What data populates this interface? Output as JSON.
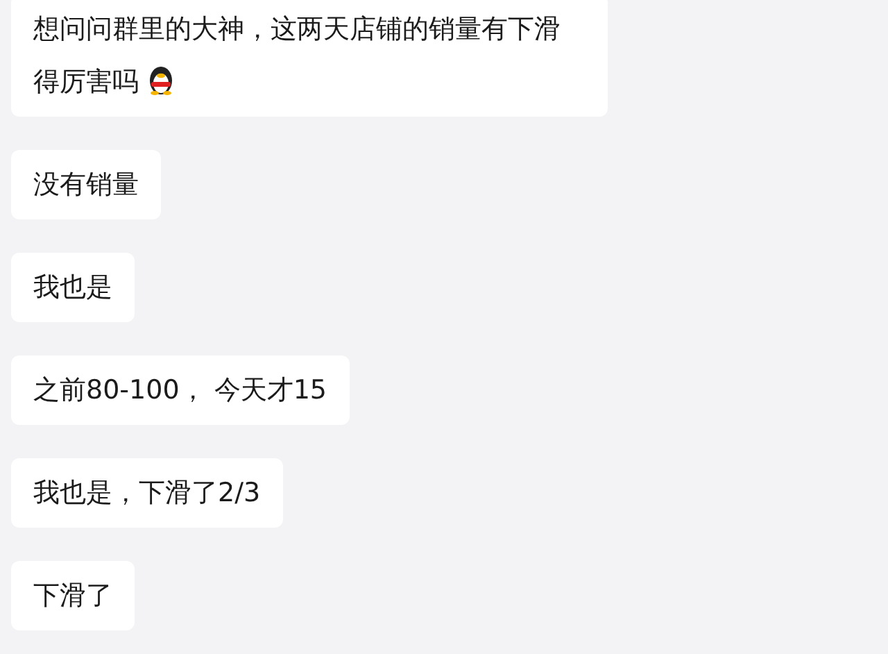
{
  "messages": [
    {
      "text": "想问问群里的大神，这两天店铺的销量有下滑得厉害吗",
      "emoji": true
    },
    {
      "text": "没有销量",
      "emoji": false
    },
    {
      "text": "我也是",
      "emoji": false
    },
    {
      "text": "之前80-100， 今天才15",
      "emoji": false
    },
    {
      "text": "我也是，下滑了2/3",
      "emoji": false
    },
    {
      "text": "下滑了",
      "emoji": false
    }
  ]
}
